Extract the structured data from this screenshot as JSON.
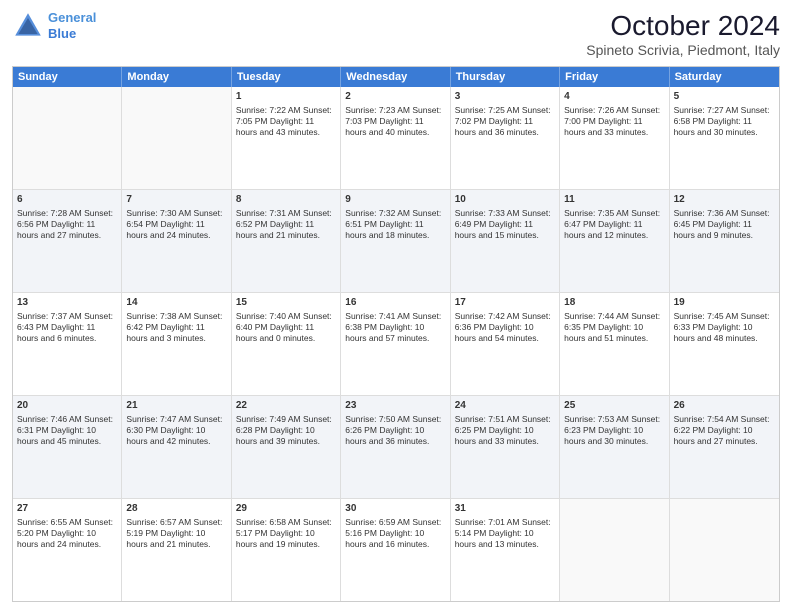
{
  "header": {
    "logo_line1": "General",
    "logo_line2": "Blue",
    "month": "October 2024",
    "location": "Spineto Scrivia, Piedmont, Italy"
  },
  "days_of_week": [
    "Sunday",
    "Monday",
    "Tuesday",
    "Wednesday",
    "Thursday",
    "Friday",
    "Saturday"
  ],
  "rows": [
    [
      {
        "day": "",
        "empty": true
      },
      {
        "day": "",
        "empty": true
      },
      {
        "day": "1",
        "sunrise": "Sunrise: 7:22 AM",
        "sunset": "Sunset: 7:05 PM",
        "daylight": "Daylight: 11 hours and 43 minutes."
      },
      {
        "day": "2",
        "sunrise": "Sunrise: 7:23 AM",
        "sunset": "Sunset: 7:03 PM",
        "daylight": "Daylight: 11 hours and 40 minutes."
      },
      {
        "day": "3",
        "sunrise": "Sunrise: 7:25 AM",
        "sunset": "Sunset: 7:02 PM",
        "daylight": "Daylight: 11 hours and 36 minutes."
      },
      {
        "day": "4",
        "sunrise": "Sunrise: 7:26 AM",
        "sunset": "Sunset: 7:00 PM",
        "daylight": "Daylight: 11 hours and 33 minutes."
      },
      {
        "day": "5",
        "sunrise": "Sunrise: 7:27 AM",
        "sunset": "Sunset: 6:58 PM",
        "daylight": "Daylight: 11 hours and 30 minutes."
      }
    ],
    [
      {
        "day": "6",
        "sunrise": "Sunrise: 7:28 AM",
        "sunset": "Sunset: 6:56 PM",
        "daylight": "Daylight: 11 hours and 27 minutes."
      },
      {
        "day": "7",
        "sunrise": "Sunrise: 7:30 AM",
        "sunset": "Sunset: 6:54 PM",
        "daylight": "Daylight: 11 hours and 24 minutes."
      },
      {
        "day": "8",
        "sunrise": "Sunrise: 7:31 AM",
        "sunset": "Sunset: 6:52 PM",
        "daylight": "Daylight: 11 hours and 21 minutes."
      },
      {
        "day": "9",
        "sunrise": "Sunrise: 7:32 AM",
        "sunset": "Sunset: 6:51 PM",
        "daylight": "Daylight: 11 hours and 18 minutes."
      },
      {
        "day": "10",
        "sunrise": "Sunrise: 7:33 AM",
        "sunset": "Sunset: 6:49 PM",
        "daylight": "Daylight: 11 hours and 15 minutes."
      },
      {
        "day": "11",
        "sunrise": "Sunrise: 7:35 AM",
        "sunset": "Sunset: 6:47 PM",
        "daylight": "Daylight: 11 hours and 12 minutes."
      },
      {
        "day": "12",
        "sunrise": "Sunrise: 7:36 AM",
        "sunset": "Sunset: 6:45 PM",
        "daylight": "Daylight: 11 hours and 9 minutes."
      }
    ],
    [
      {
        "day": "13",
        "sunrise": "Sunrise: 7:37 AM",
        "sunset": "Sunset: 6:43 PM",
        "daylight": "Daylight: 11 hours and 6 minutes."
      },
      {
        "day": "14",
        "sunrise": "Sunrise: 7:38 AM",
        "sunset": "Sunset: 6:42 PM",
        "daylight": "Daylight: 11 hours and 3 minutes."
      },
      {
        "day": "15",
        "sunrise": "Sunrise: 7:40 AM",
        "sunset": "Sunset: 6:40 PM",
        "daylight": "Daylight: 11 hours and 0 minutes."
      },
      {
        "day": "16",
        "sunrise": "Sunrise: 7:41 AM",
        "sunset": "Sunset: 6:38 PM",
        "daylight": "Daylight: 10 hours and 57 minutes."
      },
      {
        "day": "17",
        "sunrise": "Sunrise: 7:42 AM",
        "sunset": "Sunset: 6:36 PM",
        "daylight": "Daylight: 10 hours and 54 minutes."
      },
      {
        "day": "18",
        "sunrise": "Sunrise: 7:44 AM",
        "sunset": "Sunset: 6:35 PM",
        "daylight": "Daylight: 10 hours and 51 minutes."
      },
      {
        "day": "19",
        "sunrise": "Sunrise: 7:45 AM",
        "sunset": "Sunset: 6:33 PM",
        "daylight": "Daylight: 10 hours and 48 minutes."
      }
    ],
    [
      {
        "day": "20",
        "sunrise": "Sunrise: 7:46 AM",
        "sunset": "Sunset: 6:31 PM",
        "daylight": "Daylight: 10 hours and 45 minutes."
      },
      {
        "day": "21",
        "sunrise": "Sunrise: 7:47 AM",
        "sunset": "Sunset: 6:30 PM",
        "daylight": "Daylight: 10 hours and 42 minutes."
      },
      {
        "day": "22",
        "sunrise": "Sunrise: 7:49 AM",
        "sunset": "Sunset: 6:28 PM",
        "daylight": "Daylight: 10 hours and 39 minutes."
      },
      {
        "day": "23",
        "sunrise": "Sunrise: 7:50 AM",
        "sunset": "Sunset: 6:26 PM",
        "daylight": "Daylight: 10 hours and 36 minutes."
      },
      {
        "day": "24",
        "sunrise": "Sunrise: 7:51 AM",
        "sunset": "Sunset: 6:25 PM",
        "daylight": "Daylight: 10 hours and 33 minutes."
      },
      {
        "day": "25",
        "sunrise": "Sunrise: 7:53 AM",
        "sunset": "Sunset: 6:23 PM",
        "daylight": "Daylight: 10 hours and 30 minutes."
      },
      {
        "day": "26",
        "sunrise": "Sunrise: 7:54 AM",
        "sunset": "Sunset: 6:22 PM",
        "daylight": "Daylight: 10 hours and 27 minutes."
      }
    ],
    [
      {
        "day": "27",
        "sunrise": "Sunrise: 6:55 AM",
        "sunset": "Sunset: 5:20 PM",
        "daylight": "Daylight: 10 hours and 24 minutes."
      },
      {
        "day": "28",
        "sunrise": "Sunrise: 6:57 AM",
        "sunset": "Sunset: 5:19 PM",
        "daylight": "Daylight: 10 hours and 21 minutes."
      },
      {
        "day": "29",
        "sunrise": "Sunrise: 6:58 AM",
        "sunset": "Sunset: 5:17 PM",
        "daylight": "Daylight: 10 hours and 19 minutes."
      },
      {
        "day": "30",
        "sunrise": "Sunrise: 6:59 AM",
        "sunset": "Sunset: 5:16 PM",
        "daylight": "Daylight: 10 hours and 16 minutes."
      },
      {
        "day": "31",
        "sunrise": "Sunrise: 7:01 AM",
        "sunset": "Sunset: 5:14 PM",
        "daylight": "Daylight: 10 hours and 13 minutes."
      },
      {
        "day": "",
        "empty": true
      },
      {
        "day": "",
        "empty": true
      }
    ]
  ]
}
